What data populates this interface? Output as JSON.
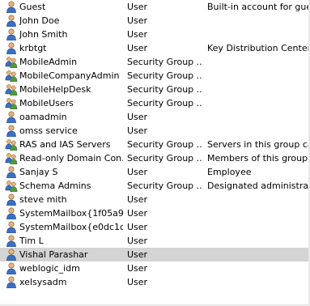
{
  "rows": [
    {
      "name": "Guest",
      "type": "User",
      "description": "Built-in account for guest",
      "icon": "user-icon",
      "selected": false
    },
    {
      "name": "John Doe",
      "type": "User",
      "description": "",
      "icon": "user-icon",
      "selected": false
    },
    {
      "name": "John Smith",
      "type": "User",
      "description": "",
      "icon": "user-icon",
      "selected": false
    },
    {
      "name": "krbtgt",
      "type": "User",
      "description": "Key Distribution Center Se",
      "icon": "user-icon",
      "selected": false
    },
    {
      "name": "MobileAdmin",
      "type": "Security Group ...",
      "description": "",
      "icon": "group-icon",
      "selected": false
    },
    {
      "name": "MobileCompanyAdmin",
      "type": "Security Group ...",
      "description": "",
      "icon": "group-icon",
      "selected": false
    },
    {
      "name": "MobileHelpDesk",
      "type": "Security Group ...",
      "description": "",
      "icon": "group-icon",
      "selected": false
    },
    {
      "name": "MobileUsers",
      "type": "Security Group ...",
      "description": "",
      "icon": "group-icon",
      "selected": false
    },
    {
      "name": "oamadmin",
      "type": "User",
      "description": "",
      "icon": "user-icon",
      "selected": false
    },
    {
      "name": "omss service",
      "type": "User",
      "description": "",
      "icon": "user-icon",
      "selected": false
    },
    {
      "name": "RAS and IAS Servers",
      "type": "Security Group ...",
      "description": "Servers in this group can .",
      "icon": "group-icon",
      "selected": false
    },
    {
      "name": "Read-only Domain Con...",
      "type": "Security Group ...",
      "description": "Members of this group are",
      "icon": "group-icon",
      "selected": false
    },
    {
      "name": "Sanjay S",
      "type": "User",
      "description": "Employee",
      "icon": "user-icon",
      "selected": false
    },
    {
      "name": "Schema Admins",
      "type": "Security Group ...",
      "description": "Designated administrators",
      "icon": "group-icon",
      "selected": false
    },
    {
      "name": "steve mith",
      "type": "User",
      "description": "",
      "icon": "user-icon",
      "selected": false
    },
    {
      "name": "SystemMailbox{1f05a9...",
      "type": "User",
      "description": "",
      "icon": "user-icon",
      "selected": false
    },
    {
      "name": "SystemMailbox{e0dc1c...",
      "type": "User",
      "description": "",
      "icon": "user-icon",
      "selected": false
    },
    {
      "name": "Tim L",
      "type": "User",
      "description": "",
      "icon": "user-icon",
      "selected": false
    },
    {
      "name": "Vishal Parashar",
      "type": "User",
      "description": "",
      "icon": "user-icon",
      "selected": true
    },
    {
      "name": "weblogic_idm",
      "type": "User",
      "description": "",
      "icon": "user-icon",
      "selected": false
    },
    {
      "name": "xelsysadm",
      "type": "User",
      "description": "",
      "icon": "user-icon",
      "selected": false
    }
  ],
  "colors": {
    "selected_row": "#d4d4d4",
    "user_head": "#e8b27a",
    "user_body": "#3a6fc4",
    "group_body": "#4f9a3a"
  }
}
